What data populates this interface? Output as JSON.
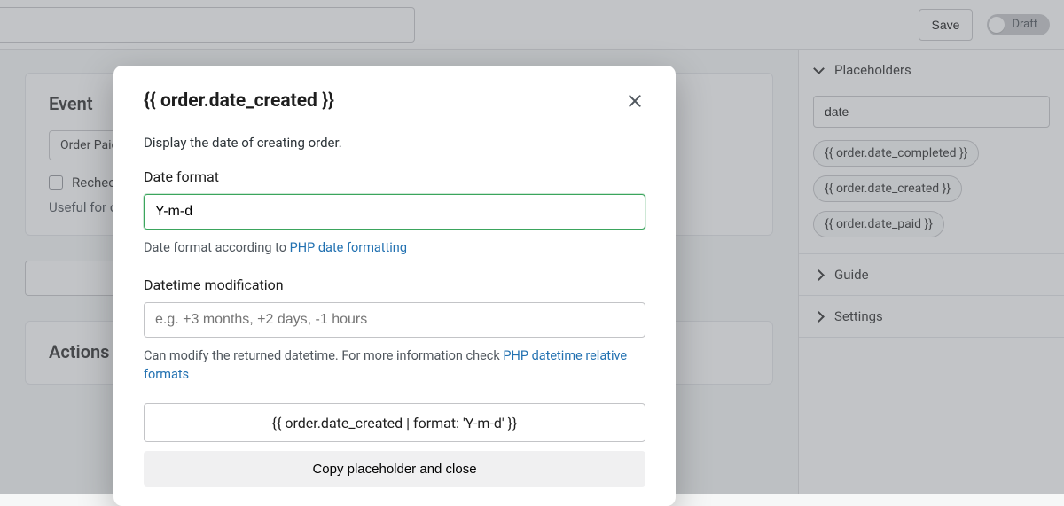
{
  "topbar": {
    "save_label": "Save",
    "toggle_label": "Draft"
  },
  "main": {
    "event_card": {
      "title": "Event",
      "select_value": "Order Paid",
      "checkbox_label": "Recheck",
      "hint_prefix": "Useful for c"
    },
    "actions_card": {
      "title": "Actions"
    }
  },
  "sidebar": {
    "placeholders": {
      "label": "Placeholders",
      "search_value": "date",
      "items": [
        "{{ order.date_completed }}",
        "{{ order.date_created }}",
        "{{ order.date_paid }}"
      ]
    },
    "guide_label": "Guide",
    "settings_label": "Settings"
  },
  "modal": {
    "title": "{{ order.date_created }}",
    "description": "Display the date of creating order.",
    "date_format": {
      "label": "Date format",
      "value": "Y-m-d",
      "help_prefix": "Date format according to ",
      "help_link": "PHP date formatting"
    },
    "datetime_mod": {
      "label": "Datetime modification",
      "placeholder": "e.g. +3 months, +2 days, -1 hours",
      "help_prefix": "Can modify the returned datetime. For more information check ",
      "help_link": "PHP datetime relative formats"
    },
    "result": "{{ order.date_created | format: 'Y-m-d' }}",
    "copy_label": "Copy placeholder and close"
  }
}
